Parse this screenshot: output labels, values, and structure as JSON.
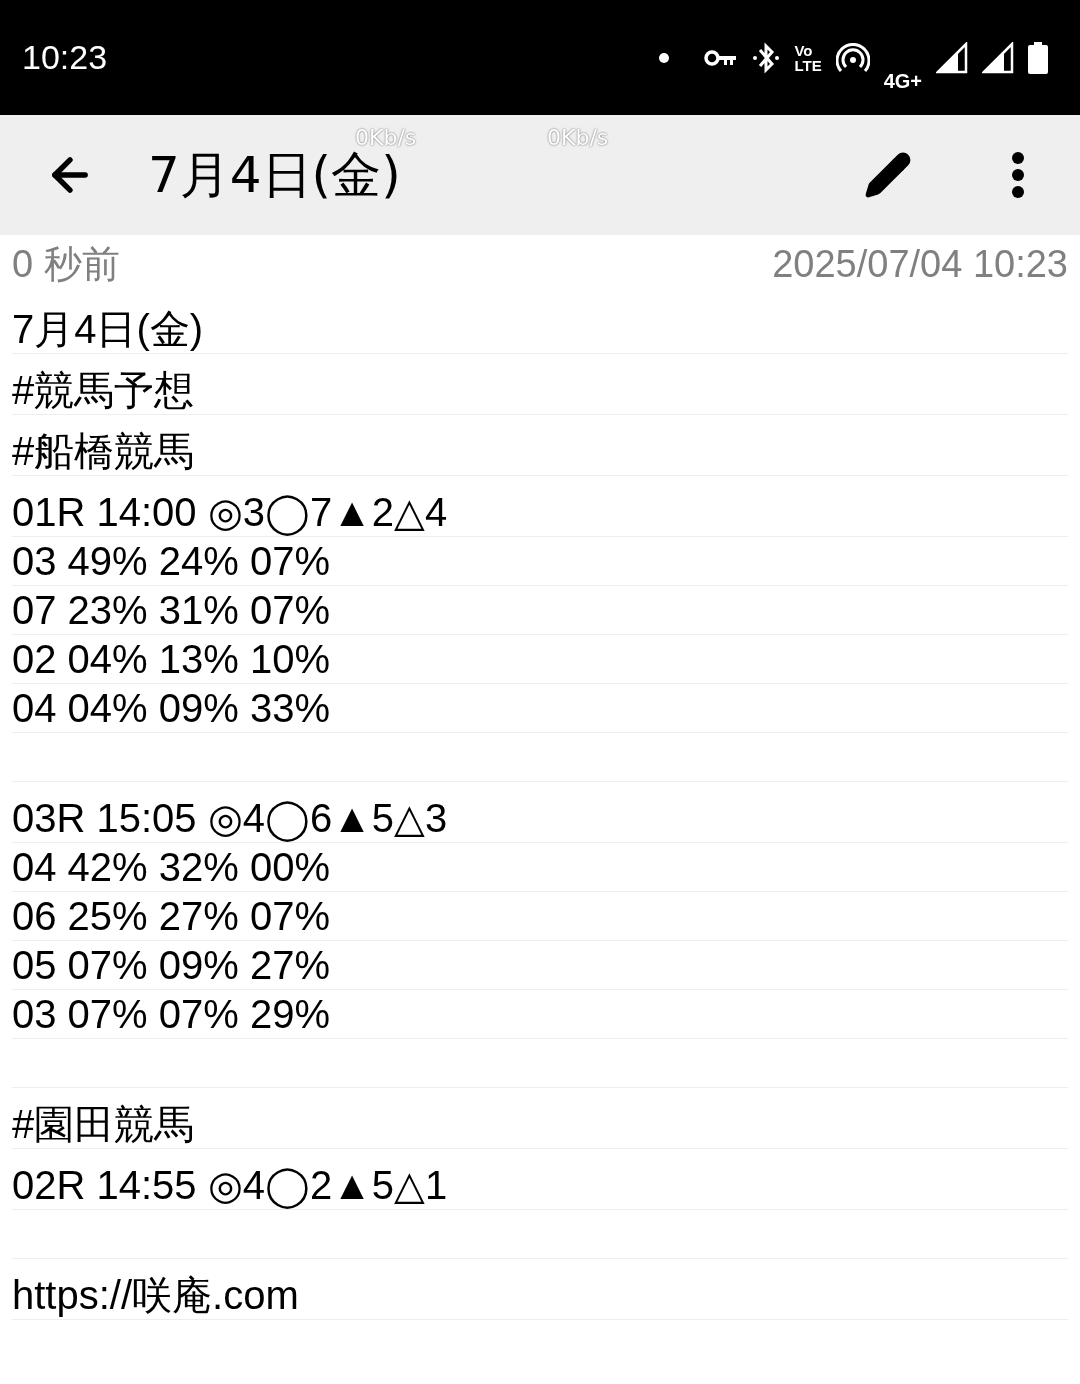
{
  "status_bar": {
    "time": "10:23",
    "network_type": "4G+",
    "volte": [
      "Vo",
      "LTE"
    ]
  },
  "speed_overlays": [
    "0Kb/s",
    "0Kb/s"
  ],
  "toolbar": {
    "title": "7月4日(金)"
  },
  "meta": {
    "relative_time": "0 秒前",
    "timestamp": "2025/07/04 10:23"
  },
  "note_lines": [
    {
      "kind": "tall",
      "text": "7月4日(金)"
    },
    {
      "kind": "tall",
      "text": "#競馬予想"
    },
    {
      "kind": "tall",
      "text": "#船橋競馬"
    },
    {
      "kind": "tall",
      "text": "01R 14:00 ◎3◯7▲2△4"
    },
    {
      "kind": "plain",
      "text": "03 49% 24% 07%"
    },
    {
      "kind": "plain",
      "text": "07 23% 31% 07%"
    },
    {
      "kind": "plain",
      "text": "02 04% 13% 10%"
    },
    {
      "kind": "plain",
      "text": "04 04% 09% 33%"
    },
    {
      "kind": "blank"
    },
    {
      "kind": "tall",
      "text": "03R 15:05 ◎4◯6▲5△3"
    },
    {
      "kind": "plain",
      "text": "04 42% 32% 00%"
    },
    {
      "kind": "plain",
      "text": "06 25% 27% 07%"
    },
    {
      "kind": "plain",
      "text": "05 07% 09% 27%"
    },
    {
      "kind": "plain",
      "text": "03 07% 07% 29%"
    },
    {
      "kind": "blank"
    },
    {
      "kind": "tall",
      "text": "#園田競馬"
    },
    {
      "kind": "tall",
      "text": "02R 14:55 ◎4◯2▲5△1"
    },
    {
      "kind": "blank"
    },
    {
      "kind": "tall",
      "text": "https://咲庵.com"
    }
  ]
}
